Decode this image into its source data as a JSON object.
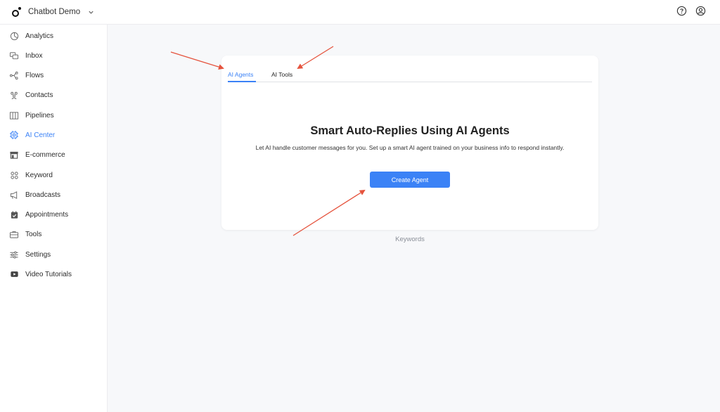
{
  "app": {
    "name": "Chatbot Demo"
  },
  "topbar": {
    "icons": [
      "help-icon",
      "account-icon"
    ]
  },
  "sidebar": {
    "items": [
      {
        "label": "Analytics",
        "icon": "analytics-icon"
      },
      {
        "label": "Inbox",
        "icon": "inbox-icon"
      },
      {
        "label": "Flows",
        "icon": "flows-icon"
      },
      {
        "label": "Contacts",
        "icon": "contacts-icon"
      },
      {
        "label": "Pipelines",
        "icon": "pipelines-icon"
      },
      {
        "label": "AI Center",
        "icon": "ai-chip-icon",
        "active": true
      },
      {
        "label": "E-commerce",
        "icon": "store-icon"
      },
      {
        "label": "Keyword",
        "icon": "keyword-icon"
      },
      {
        "label": "Broadcasts",
        "icon": "megaphone-icon"
      },
      {
        "label": "Appointments",
        "icon": "calendar-icon"
      },
      {
        "label": "Tools",
        "icon": "toolbox-icon"
      },
      {
        "label": "Settings",
        "icon": "sliders-icon"
      },
      {
        "label": "Video Tutorials",
        "icon": "video-icon"
      }
    ]
  },
  "card": {
    "tabs": [
      {
        "label": "AI Agents",
        "active": true
      },
      {
        "label": "AI Tools",
        "active": false
      }
    ],
    "headline": "Smart Auto-Replies Using AI Agents",
    "description": "Let AI handle customer messages for you. Set up a smart AI agent trained on your business info to respond instantly.",
    "create_button": "Create Agent"
  },
  "footer_link": "Keywords",
  "colors": {
    "accent": "#3b82f6",
    "annotation": "#e5533d",
    "background": "#f7f8fa"
  }
}
